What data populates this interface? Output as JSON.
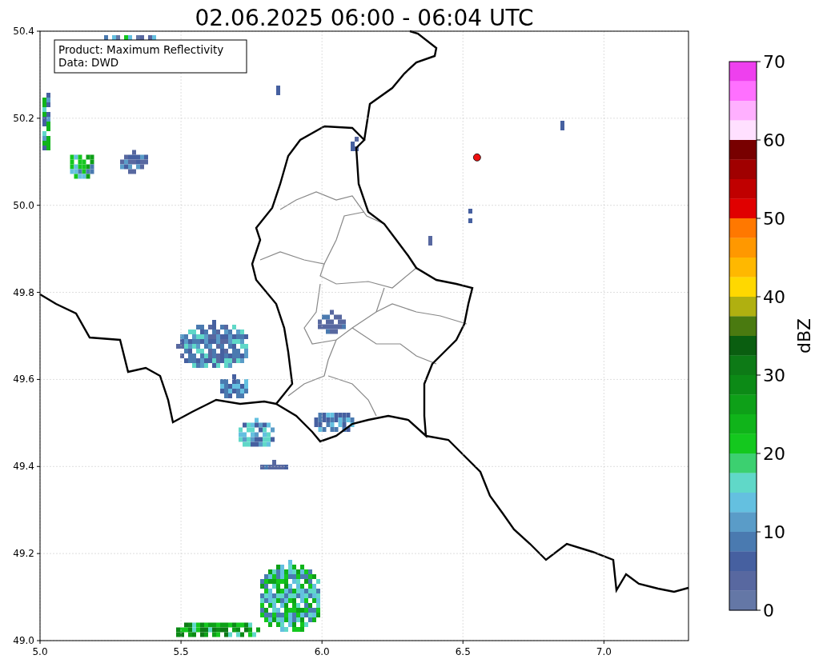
{
  "title": "02.06.2025 06:00 - 06:04 UTC",
  "annotation": [
    "Product: Maximum Reflectivity",
    "Data: DWD"
  ],
  "map": {
    "chart_data": {
      "type": "scatter",
      "xlim": [
        5.0,
        7.3
      ],
      "ylim": [
        49.0,
        50.4
      ],
      "xticks": [
        {
          "value": 5.0,
          "label": "5.0"
        },
        {
          "value": 5.5,
          "label": "5.5"
        },
        {
          "value": 6.0,
          "label": "6.0"
        },
        {
          "value": 6.5,
          "label": "6.5"
        },
        {
          "value": 7.0,
          "label": "7.0"
        }
      ],
      "yticks": [
        {
          "value": 49.0,
          "label": "49.0"
        },
        {
          "value": 49.2,
          "label": "49.2"
        },
        {
          "value": 49.4,
          "label": "49.4"
        },
        {
          "value": 49.6,
          "label": "49.6"
        },
        {
          "value": 49.8,
          "label": "49.8"
        },
        {
          "value": 50.0,
          "label": "50.0"
        },
        {
          "value": 50.2,
          "label": "50.2"
        },
        {
          "value": 50.4,
          "label": "50.4"
        }
      ],
      "grid": true,
      "x": [
        6.55
      ],
      "series": [
        {
          "color": "#ee1111",
          "values": [
            50.11
          ]
        }
      ]
    }
  },
  "colorbar": {
    "label": "dBZ",
    "ticks": [
      "70",
      "60",
      "50",
      "40",
      "30",
      "20",
      "10",
      "0"
    ],
    "segments": [
      {
        "color": "#ee40ee"
      },
      {
        "color": "#ff70ff"
      },
      {
        "color": "#ffb0ff"
      },
      {
        "color": "#ffe0ff"
      },
      {
        "color": "#780000"
      },
      {
        "color": "#a00000"
      },
      {
        "color": "#c00000"
      },
      {
        "color": "#e00000"
      },
      {
        "color": "#ff7800"
      },
      {
        "color": "#ff9800"
      },
      {
        "color": "#ffb800"
      },
      {
        "color": "#ffd800"
      },
      {
        "color": "#b0b010"
      },
      {
        "color": "#4a7a10"
      },
      {
        "color": "#0a5e10"
      },
      {
        "color": "#0d7a16"
      },
      {
        "color": "#0c8a16"
      },
      {
        "color": "#0ea018"
      },
      {
        "color": "#10b41a"
      },
      {
        "color": "#14c81e"
      },
      {
        "color": "#3cd070"
      },
      {
        "color": "#60d8c8"
      },
      {
        "color": "#64c0e0"
      },
      {
        "color": "#5a9cc8"
      },
      {
        "color": "#4a7ab0"
      },
      {
        "color": "#4660a0"
      },
      {
        "color": "#5868a0"
      },
      {
        "color": "#6477a6"
      }
    ]
  }
}
